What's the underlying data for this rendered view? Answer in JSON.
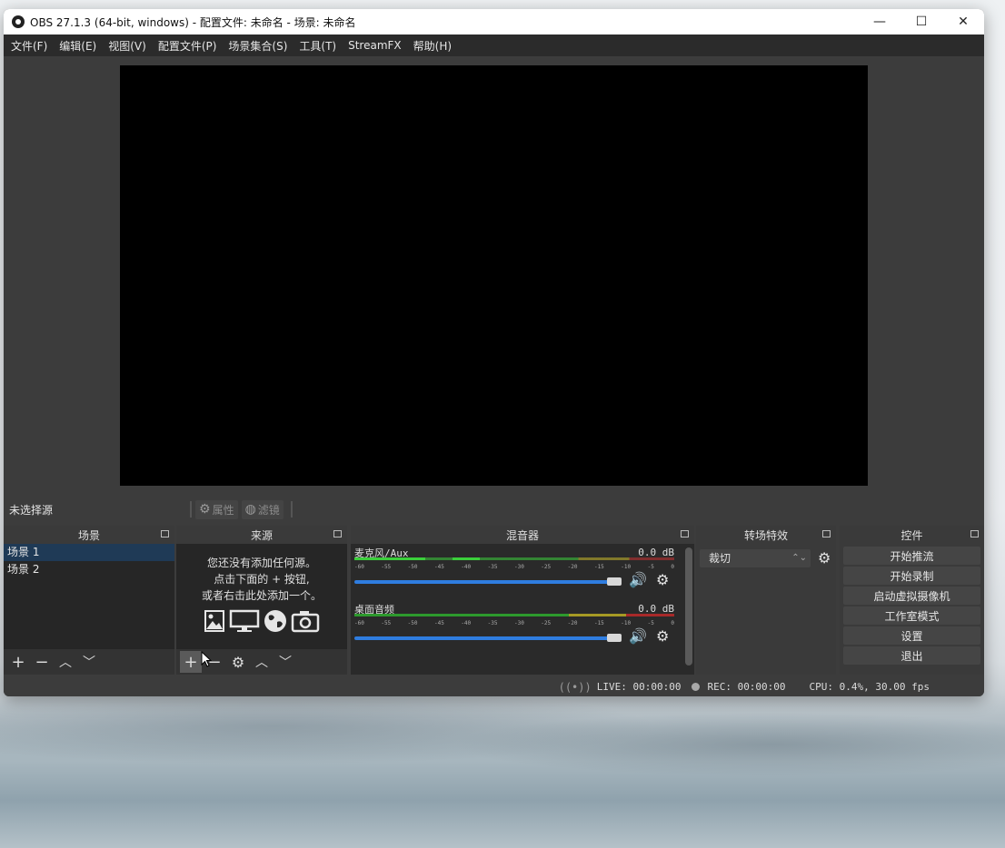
{
  "window": {
    "title": "OBS 27.1.3 (64-bit, windows) - 配置文件: 未命名 - 场景: 未命名",
    "minimize": "—",
    "maximize": "☐",
    "close": "✕"
  },
  "menu": [
    "文件(F)",
    "编辑(E)",
    "视图(V)",
    "配置文件(P)",
    "场景集合(S)",
    "工具(T)",
    "StreamFX",
    "帮助(H)"
  ],
  "source_toolbar": {
    "no_source": "未选择源",
    "properties": "属性",
    "filters": "滤镜"
  },
  "scenes": {
    "title": "场景",
    "items": [
      "场景 1",
      "场景 2"
    ],
    "selected_index": 0
  },
  "sources": {
    "title": "来源",
    "empty_line1": "您还没有添加任何源。",
    "empty_line2": "点击下面的 + 按钮,",
    "empty_line3": "或者右击此处添加一个。"
  },
  "mixer": {
    "title": "混音器",
    "channels": [
      {
        "name": "麦克风/Aux",
        "db": "0.0 dB"
      },
      {
        "name": "桌面音频",
        "db": "0.0 dB"
      }
    ],
    "ticks": [
      "-60",
      "-55",
      "-50",
      "-45",
      "-40",
      "-35",
      "-30",
      "-25",
      "-20",
      "-15",
      "-10",
      "-5",
      "0"
    ]
  },
  "transitions": {
    "title": "转场特效",
    "selected": "裁切"
  },
  "controls": {
    "title": "控件",
    "buttons": [
      "开始推流",
      "开始录制",
      "启动虚拟摄像机",
      "工作室模式",
      "设置",
      "退出"
    ]
  },
  "status": {
    "live": "LIVE: 00:00:00",
    "rec": "REC: 00:00:00",
    "cpu": "CPU: 0.4%, 30.00 fps"
  },
  "colors": {
    "meter_green": "#3bcf3b",
    "meter_yellow": "#c8b92b",
    "meter_red": "#c83232",
    "slider_blue": "#2f7de0"
  }
}
